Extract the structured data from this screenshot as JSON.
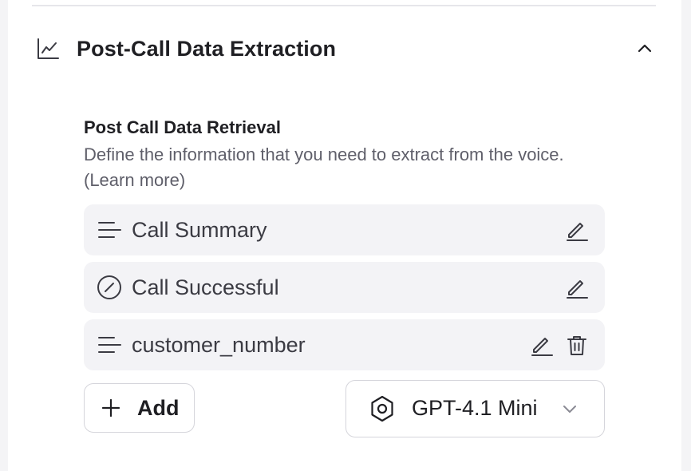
{
  "section": {
    "title": "Post-Call Data Extraction",
    "icon": "line-chart-icon",
    "expanded": true
  },
  "retrieval": {
    "title": "Post Call Data Retrieval",
    "description": "Define the information that you need to extract from the voice. (Learn more)"
  },
  "items": [
    {
      "label": "Call Summary",
      "icon": "text-lines-icon",
      "has_delete": false
    },
    {
      "label": "Call Successful",
      "icon": "circle-slash-icon",
      "has_delete": false
    },
    {
      "label": "customer_number",
      "icon": "text-lines-icon",
      "has_delete": true
    }
  ],
  "actions": {
    "add_label": "Add",
    "model_label": "GPT-4.1 Mini"
  },
  "colors": {
    "item_bg": "#f3f3f6",
    "text_primary": "#1f1f23",
    "text_secondary": "#5f5f6a",
    "border": "#d5d5db"
  }
}
